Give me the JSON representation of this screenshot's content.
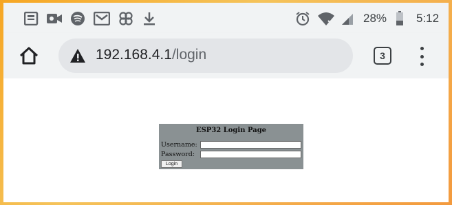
{
  "status_bar": {
    "left_icons": [
      "news-icon",
      "video-call-icon",
      "spotify-icon",
      "gmail-icon",
      "pinwheel-icon",
      "download-icon"
    ],
    "right_icons": [
      "alarm-icon",
      "wifi-icon",
      "signal-icon",
      "battery-icon"
    ],
    "battery": "28%",
    "time": "5:12"
  },
  "toolbar": {
    "url_host": "192.168.4.1",
    "url_path": "/login",
    "tab_count": "3"
  },
  "login": {
    "title": "ESP32 Login Page",
    "username_label": "Username:",
    "password_label": "Password:",
    "username_value": "",
    "password_value": "",
    "button_label": "Login"
  }
}
